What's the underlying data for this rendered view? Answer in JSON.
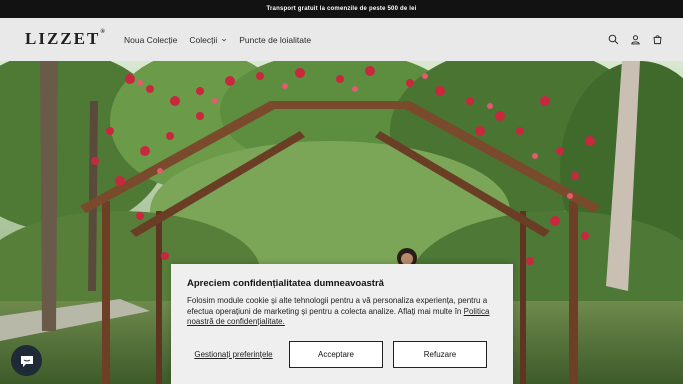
{
  "announcement": {
    "text": "Transport gratuit la comenzile de peste 500 de lei"
  },
  "header": {
    "logo": "LIZZET",
    "logo_mark": "®",
    "nav": [
      {
        "label": "Noua Colecție"
      },
      {
        "label": "Colecții",
        "has_dropdown": true
      },
      {
        "label": "Puncte de loialitate"
      }
    ],
    "icons": [
      "search-icon",
      "account-icon",
      "cart-icon"
    ]
  },
  "hero": {
    "image": "rose-covered wooden pergola in a green park"
  },
  "cookie_banner": {
    "title": "Apreciem confidențialitatea dumneavoastră",
    "text": "Folosim module cookie și alte tehnologii pentru a vă personaliza experiența, pentru a efectua operațiuni de marketing și pentru a colecta analize. Aflați mai multe în ",
    "link_label": "Politica noastră de confidențialitate.",
    "preferences_label": "Gestionați preferințele",
    "accept_label": "Acceptare",
    "refuse_label": "Refuzare"
  },
  "chat": {
    "icon": "chat-icon"
  },
  "colors": {
    "announcement_bg": "#121212",
    "header_bg": "#e9e9e9",
    "banner_bg": "#efefef",
    "chat_bg": "#1e2a36"
  }
}
